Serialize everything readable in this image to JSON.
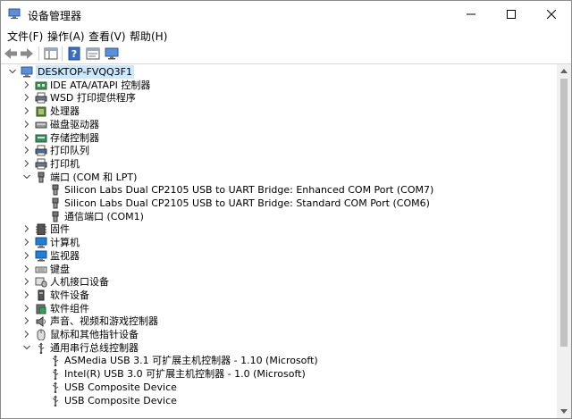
{
  "window": {
    "title": "设备管理器"
  },
  "menu": [
    "文件(F)",
    "操作(A)",
    "查看(V)",
    "帮助(H)"
  ],
  "tree": [
    {
      "label": "DESKTOP-FVQQ3F1",
      "level": 0,
      "chev": "down",
      "icon": "computer-icon"
    },
    {
      "label": "IDE ATA/ATAPI 控制器",
      "level": 1,
      "chev": "right",
      "icon": "ide-controller-icon"
    },
    {
      "label": "WSD 打印提供程序",
      "level": 1,
      "chev": "right",
      "icon": "printer-icon"
    },
    {
      "label": "处理器",
      "level": 1,
      "chev": "right",
      "icon": "processor-icon"
    },
    {
      "label": "磁盘驱动器",
      "level": 1,
      "chev": "right",
      "icon": "disk-drive-icon"
    },
    {
      "label": "存储控制器",
      "level": 1,
      "chev": "right",
      "icon": "storage-controller-icon"
    },
    {
      "label": "打印队列",
      "level": 1,
      "chev": "right",
      "icon": "print-queue-icon"
    },
    {
      "label": "打印机",
      "level": 1,
      "chev": "right",
      "icon": "printer-icon"
    },
    {
      "label": "端口 (COM 和 LPT)",
      "level": 1,
      "chev": "down",
      "icon": "port-icon"
    },
    {
      "label": "Silicon Labs Dual CP2105 USB to UART Bridge: Enhanced COM Port (COM7)",
      "level": 2,
      "chev": "",
      "icon": "port-icon"
    },
    {
      "label": "Silicon Labs Dual CP2105 USB to UART Bridge: Standard COM Port (COM6)",
      "level": 2,
      "chev": "",
      "icon": "port-icon"
    },
    {
      "label": "通信端口 (COM1)",
      "level": 2,
      "chev": "",
      "icon": "port-icon"
    },
    {
      "label": "固件",
      "level": 1,
      "chev": "right",
      "icon": "firmware-icon"
    },
    {
      "label": "计算机",
      "level": 1,
      "chev": "right",
      "icon": "monitor-icon"
    },
    {
      "label": "监视器",
      "level": 1,
      "chev": "right",
      "icon": "monitor-icon"
    },
    {
      "label": "键盘",
      "level": 1,
      "chev": "right",
      "icon": "keyboard-icon"
    },
    {
      "label": "人机接口设备",
      "level": 1,
      "chev": "right",
      "icon": "hid-icon"
    },
    {
      "label": "软件设备",
      "level": 1,
      "chev": "right",
      "icon": "software-device-icon"
    },
    {
      "label": "软件组件",
      "level": 1,
      "chev": "right",
      "icon": "software-component-icon"
    },
    {
      "label": "声音、视频和游戏控制器",
      "level": 1,
      "chev": "right",
      "icon": "speaker-icon"
    },
    {
      "label": "鼠标和其他指针设备",
      "level": 1,
      "chev": "right",
      "icon": "mouse-icon"
    },
    {
      "label": "通用串行总线控制器",
      "level": 1,
      "chev": "down",
      "icon": "usb-icon"
    },
    {
      "label": "ASMedia USB 3.1 可扩展主机控制器 - 1.10 (Microsoft)",
      "level": 2,
      "chev": "",
      "icon": "usb-icon"
    },
    {
      "label": "Intel(R) USB 3.0 可扩展主机控制器 - 1.0 (Microsoft)",
      "level": 2,
      "chev": "",
      "icon": "usb-icon"
    },
    {
      "label": "USB Composite Device",
      "level": 2,
      "chev": "",
      "icon": "usb-icon"
    },
    {
      "label": "USB Composite Device",
      "level": 2,
      "chev": "",
      "icon": "usb-icon"
    }
  ]
}
